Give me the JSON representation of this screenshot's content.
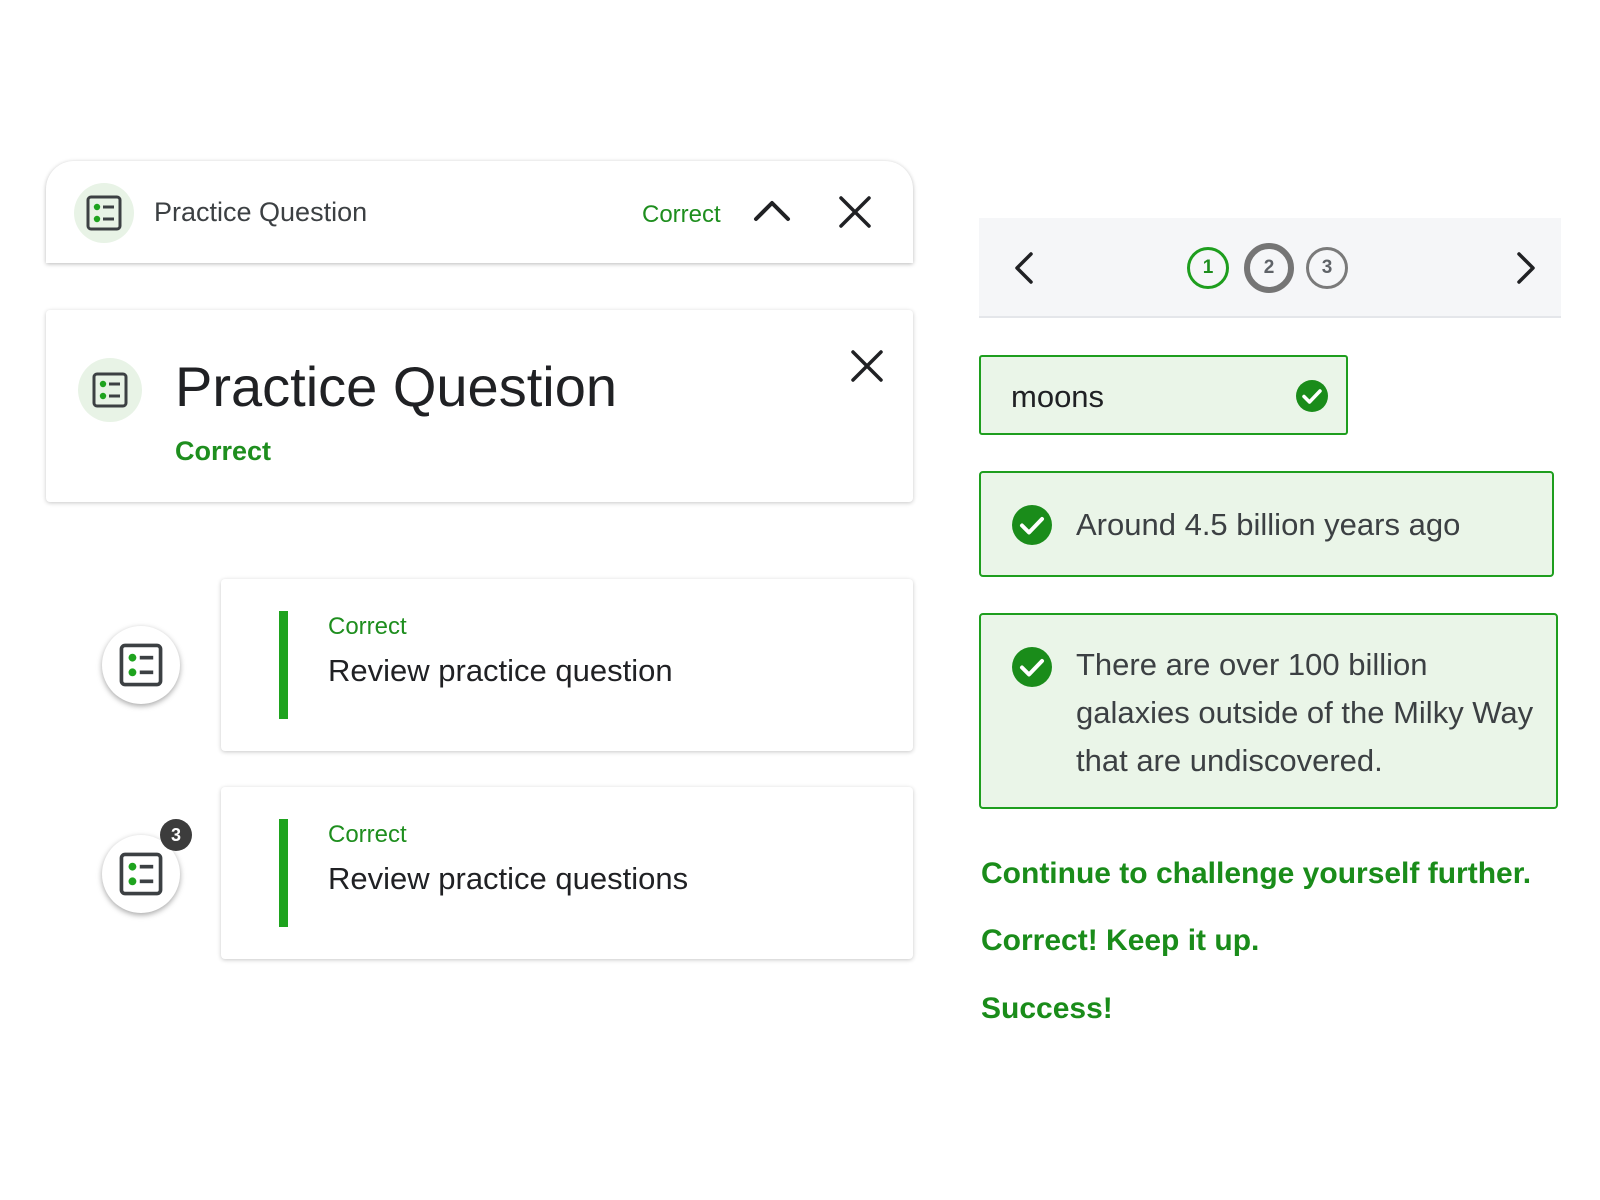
{
  "header_bar": {
    "title": "Practice Question",
    "status": "Correct"
  },
  "expanded_card": {
    "title": "Practice Question",
    "status": "Correct"
  },
  "review_items": [
    {
      "status": "Correct",
      "label": "Review practice question",
      "badge": ""
    },
    {
      "status": "Correct",
      "label": "Review practice questions",
      "badge": "3"
    }
  ],
  "stepper": {
    "steps": [
      "1",
      "2",
      "3"
    ],
    "active_step": "2"
  },
  "answer_field": {
    "value": "moons"
  },
  "options": [
    {
      "text": "Around 4.5 billion years ago"
    },
    {
      "text": "There are over 100 billion galaxies outside of the Milky Way that are undiscovered."
    }
  ],
  "feedback": [
    "Continue to challenge yourself further.",
    "Correct! Keep it up.",
    "Success!"
  ],
  "colors": {
    "accent_green": "#1e8e1e",
    "correct_fill": "#eaf5e8",
    "icon_circle": "#e8f3e6"
  },
  "icons": {
    "practice": "practice-question-icon",
    "collapse": "chevron-up-icon",
    "close": "close-icon",
    "prev": "chevron-left-icon",
    "next": "chevron-right-icon",
    "check": "check-circle-icon"
  }
}
